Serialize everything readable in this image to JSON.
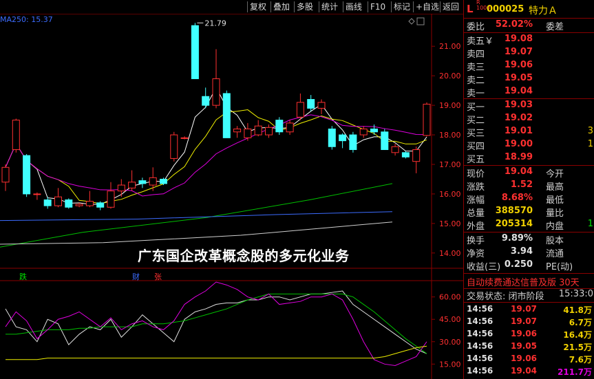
{
  "toolbar": {
    "buttons": [
      "复权",
      "叠加",
      "多股",
      "统计",
      "画线",
      "F10",
      "标记",
      "+自选",
      "返回"
    ]
  },
  "ma_label": "MA250: 15.37",
  "high_annotation": "21.79",
  "caption": "广东国企改革概念股的多元化业务",
  "markers": {
    "die": "跌",
    "cai": "财",
    "zhang": "张"
  },
  "price_axis": [
    "21.00",
    "20.00",
    "19.00",
    "18.00",
    "17.00",
    "16.00",
    "15.00",
    "14.00"
  ],
  "ind_axis": [
    "60.00",
    "45.00",
    "30.00",
    "15.00"
  ],
  "stock": {
    "flag": "L",
    "r_small": "R",
    "r_num": "1000",
    "code": "000025",
    "name": "特力Ａ"
  },
  "weibi": {
    "label": "委比",
    "value": "52.02%",
    "label2": "委差"
  },
  "sells": [
    {
      "label": "卖五￥",
      "price": "19.08"
    },
    {
      "label": "卖四",
      "price": "19.07"
    },
    {
      "label": "卖三",
      "price": "19.06"
    },
    {
      "label": "卖二",
      "price": "19.05"
    },
    {
      "label": "卖一",
      "price": "19.04"
    }
  ],
  "buys": [
    {
      "label": "买一",
      "price": "19.03",
      "vol": ""
    },
    {
      "label": "买二",
      "price": "19.02",
      "vol": ""
    },
    {
      "label": "买三",
      "price": "19.01",
      "vol": "3"
    },
    {
      "label": "买四",
      "price": "19.00",
      "vol": "1"
    },
    {
      "label": "买五",
      "price": "18.99",
      "vol": ""
    }
  ],
  "quote": [
    {
      "l1": "现价",
      "v1": "19.04",
      "l2": "今开"
    },
    {
      "l1": "涨跌",
      "v1": "1.52",
      "l2": "最高"
    },
    {
      "l1": "涨幅",
      "v1": "8.68%",
      "l2": "最低"
    },
    {
      "l1": "总量",
      "v1": "388570",
      "l2": "量比"
    },
    {
      "l1": "外盘",
      "v1": "205314",
      "l2": "内盘",
      "v3": "1"
    }
  ],
  "fund": [
    {
      "l1": "换手",
      "v1": "9.89%",
      "l2": "股本"
    },
    {
      "l1": "净资",
      "v1": "3.94",
      "l2": "流通"
    },
    {
      "l1": "收益(三)",
      "v1": "0.250",
      "l2": "PE(动)"
    }
  ],
  "ticker": "自动续费通达信普及版  30天",
  "status": {
    "label": "交易状态: 闭市阶段",
    "time": "15:33:0"
  },
  "ticks": [
    {
      "t": "14:56",
      "p": "19.07",
      "v": "41.8万"
    },
    {
      "t": "14:56",
      "p": "19.07",
      "v": "6.7万"
    },
    {
      "t": "14:56",
      "p": "19.06",
      "v": "16.4万"
    },
    {
      "t": "14:56",
      "p": "19.05",
      "v": "21.5万"
    },
    {
      "t": "14:56",
      "p": "19.06",
      "v": "7.6万"
    },
    {
      "t": "14:56",
      "p": "19.04",
      "v": "211.7万"
    }
  ],
  "chart_data": {
    "type": "candlestick",
    "y_range": [
      13.6,
      22.1
    ],
    "candles": [
      {
        "o": 16.4,
        "c": 16.9,
        "h": 17.0,
        "l": 16.1
      },
      {
        "o": 17.5,
        "c": 18.5,
        "h": 18.55,
        "l": 17.4
      },
      {
        "o": 17.3,
        "c": 16.0,
        "h": 17.35,
        "l": 15.9
      },
      {
        "o": 16.0,
        "c": 16.0,
        "h": 16.05,
        "l": 15.8
      },
      {
        "o": 15.8,
        "c": 15.6,
        "h": 15.9,
        "l": 15.5
      },
      {
        "o": 15.6,
        "c": 15.9,
        "h": 16.2,
        "l": 15.55
      },
      {
        "o": 15.8,
        "c": 15.55,
        "h": 15.85,
        "l": 15.5
      },
      {
        "o": 15.6,
        "c": 15.65,
        "h": 15.7,
        "l": 15.55
      },
      {
        "o": 15.6,
        "c": 15.75,
        "h": 16.1,
        "l": 15.55
      },
      {
        "o": 15.7,
        "c": 15.55,
        "h": 15.75,
        "l": 15.45
      },
      {
        "o": 15.55,
        "c": 16.1,
        "h": 16.4,
        "l": 15.5
      },
      {
        "o": 16.1,
        "c": 16.3,
        "h": 16.5,
        "l": 15.9
      },
      {
        "o": 16.2,
        "c": 16.4,
        "h": 16.8,
        "l": 16.1
      },
      {
        "o": 16.45,
        "c": 16.35,
        "h": 16.55,
        "l": 16.2
      },
      {
        "o": 16.3,
        "c": 16.55,
        "h": 16.9,
        "l": 16.1
      },
      {
        "o": 16.5,
        "c": 16.35,
        "h": 16.55,
        "l": 16.3
      },
      {
        "o": 17.2,
        "c": 18.0,
        "h": 18.1,
        "l": 17.1
      },
      {
        "o": 17.9,
        "c": 17.9,
        "h": 17.95,
        "l": 17.85
      },
      {
        "o": 21.7,
        "c": 19.9,
        "h": 21.79,
        "l": 19.9
      },
      {
        "o": 19.3,
        "c": 19.0,
        "h": 19.6,
        "l": 18.9
      },
      {
        "o": 19.0,
        "c": 19.9,
        "h": 20.9,
        "l": 18.9
      },
      {
        "o": 19.4,
        "c": 17.9,
        "h": 19.5,
        "l": 17.9
      },
      {
        "o": 18.1,
        "c": 18.2,
        "h": 18.3,
        "l": 17.9
      },
      {
        "o": 17.9,
        "c": 18.2,
        "h": 18.4,
        "l": 17.8
      },
      {
        "o": 18.0,
        "c": 18.3,
        "h": 18.5,
        "l": 17.95
      },
      {
        "o": 18.0,
        "c": 18.25,
        "h": 18.35,
        "l": 17.9
      },
      {
        "o": 18.5,
        "c": 18.1,
        "h": 18.6,
        "l": 18.0
      },
      {
        "o": 18.1,
        "c": 18.4,
        "h": 18.5,
        "l": 18.0
      },
      {
        "o": 18.6,
        "c": 19.1,
        "h": 19.4,
        "l": 18.5
      },
      {
        "o": 19.2,
        "c": 18.9,
        "h": 19.35,
        "l": 18.8
      },
      {
        "o": 18.9,
        "c": 19.1,
        "h": 19.2,
        "l": 18.7
      },
      {
        "o": 18.2,
        "c": 17.6,
        "h": 18.3,
        "l": 17.5
      },
      {
        "o": 18.0,
        "c": 17.8,
        "h": 18.05,
        "l": 17.55
      },
      {
        "o": 18.0,
        "c": 17.5,
        "h": 18.1,
        "l": 17.4
      },
      {
        "o": 18.0,
        "c": 18.2,
        "h": 18.3,
        "l": 17.9
      },
      {
        "o": 18.2,
        "c": 18.1,
        "h": 18.35,
        "l": 18.0
      },
      {
        "o": 18.1,
        "c": 17.5,
        "h": 18.2,
        "l": 17.5
      },
      {
        "o": 17.4,
        "c": 17.6,
        "h": 17.7,
        "l": 17.3
      },
      {
        "o": 17.4,
        "c": 17.25,
        "h": 17.45,
        "l": 17.2
      },
      {
        "o": 17.1,
        "c": 17.5,
        "h": 17.6,
        "l": 16.7
      },
      {
        "o": 17.98,
        "c": 19.04,
        "h": 19.1,
        "l": 17.95
      }
    ]
  }
}
